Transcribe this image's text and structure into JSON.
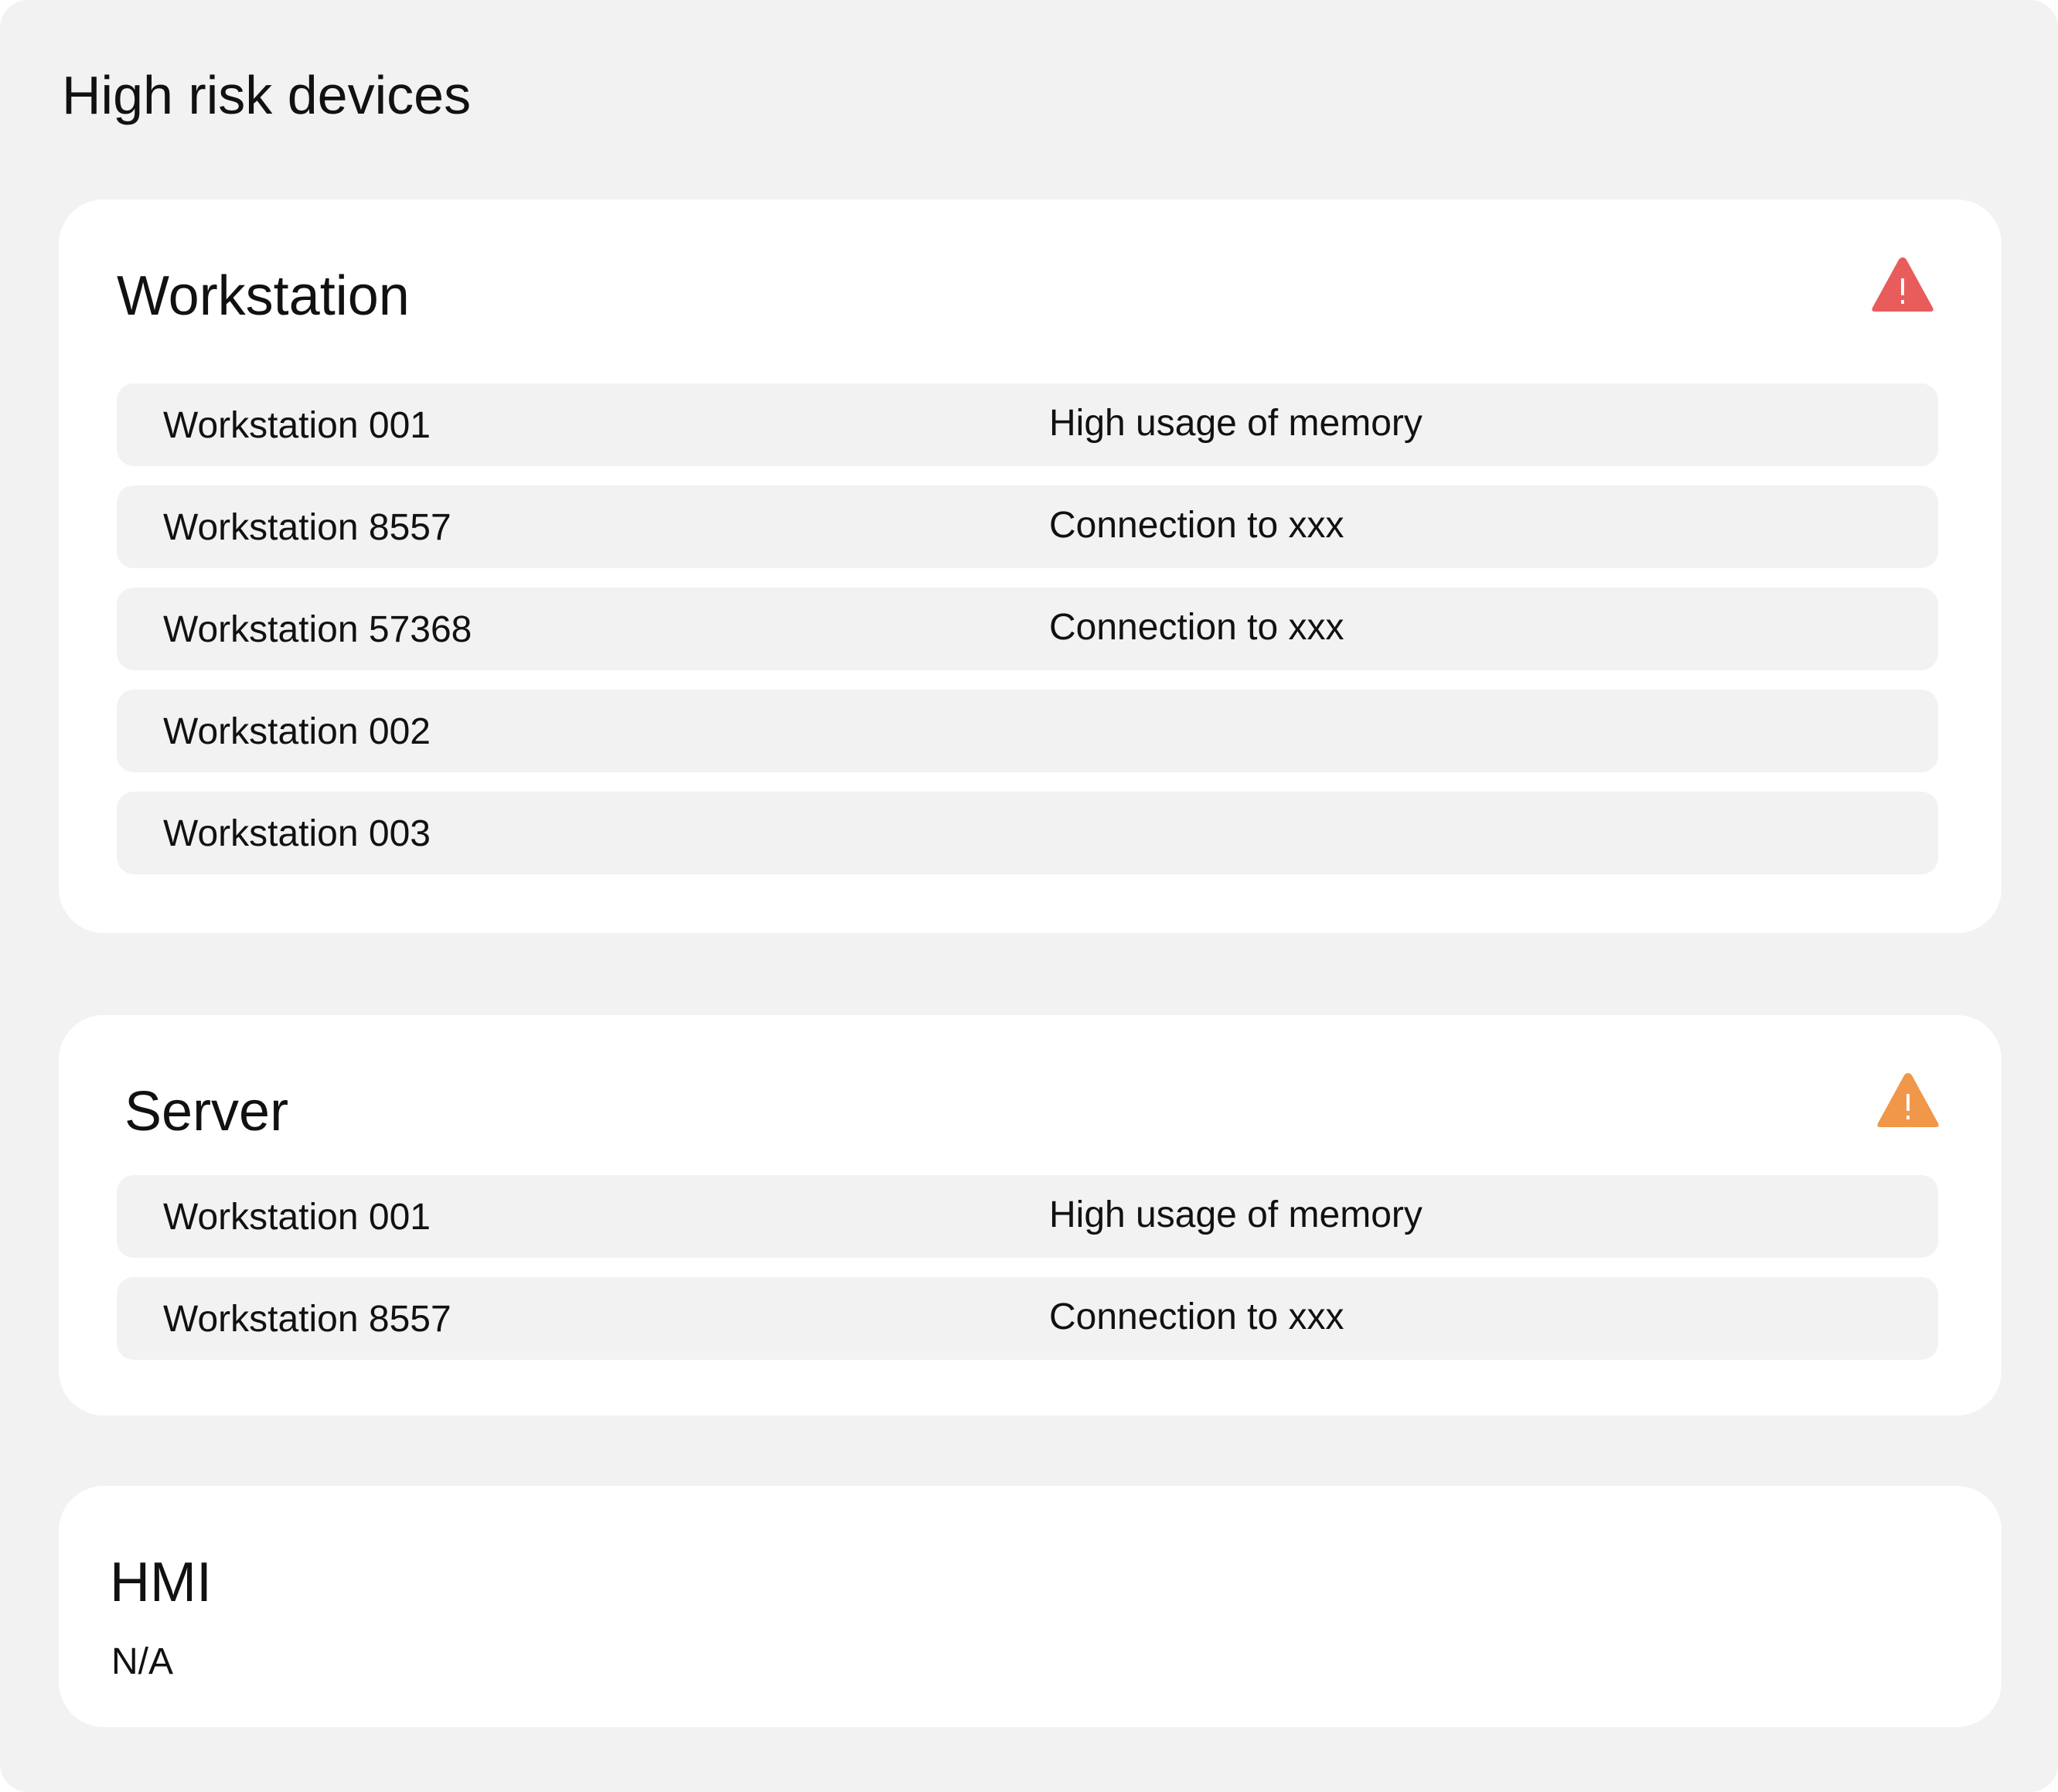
{
  "page": {
    "title": "High risk devices"
  },
  "colors": {
    "critical": "#e85c5c",
    "warning": "#f0974a"
  },
  "sections": [
    {
      "title": "Workstation",
      "icon": "warning-triangle-icon",
      "severity_color": "#e85c5c",
      "rows": [
        {
          "name": "Workstation 001",
          "issue": "High usage of memory"
        },
        {
          "name": "Workstation 8557",
          "issue": "Connection to xxx"
        },
        {
          "name": "Workstation 57368",
          "issue": "Connection to xxx"
        },
        {
          "name": "Workstation 002",
          "issue": ""
        },
        {
          "name": "Workstation 003",
          "issue": ""
        }
      ]
    },
    {
      "title": "Server",
      "icon": "warning-triangle-icon",
      "severity_color": "#f0974a",
      "rows": [
        {
          "name": "Workstation 001",
          "issue": "High usage of memory"
        },
        {
          "name": "Workstation 8557",
          "issue": "Connection to xxx"
        }
      ]
    },
    {
      "title": "HMI",
      "empty_text": "N/A"
    }
  ]
}
